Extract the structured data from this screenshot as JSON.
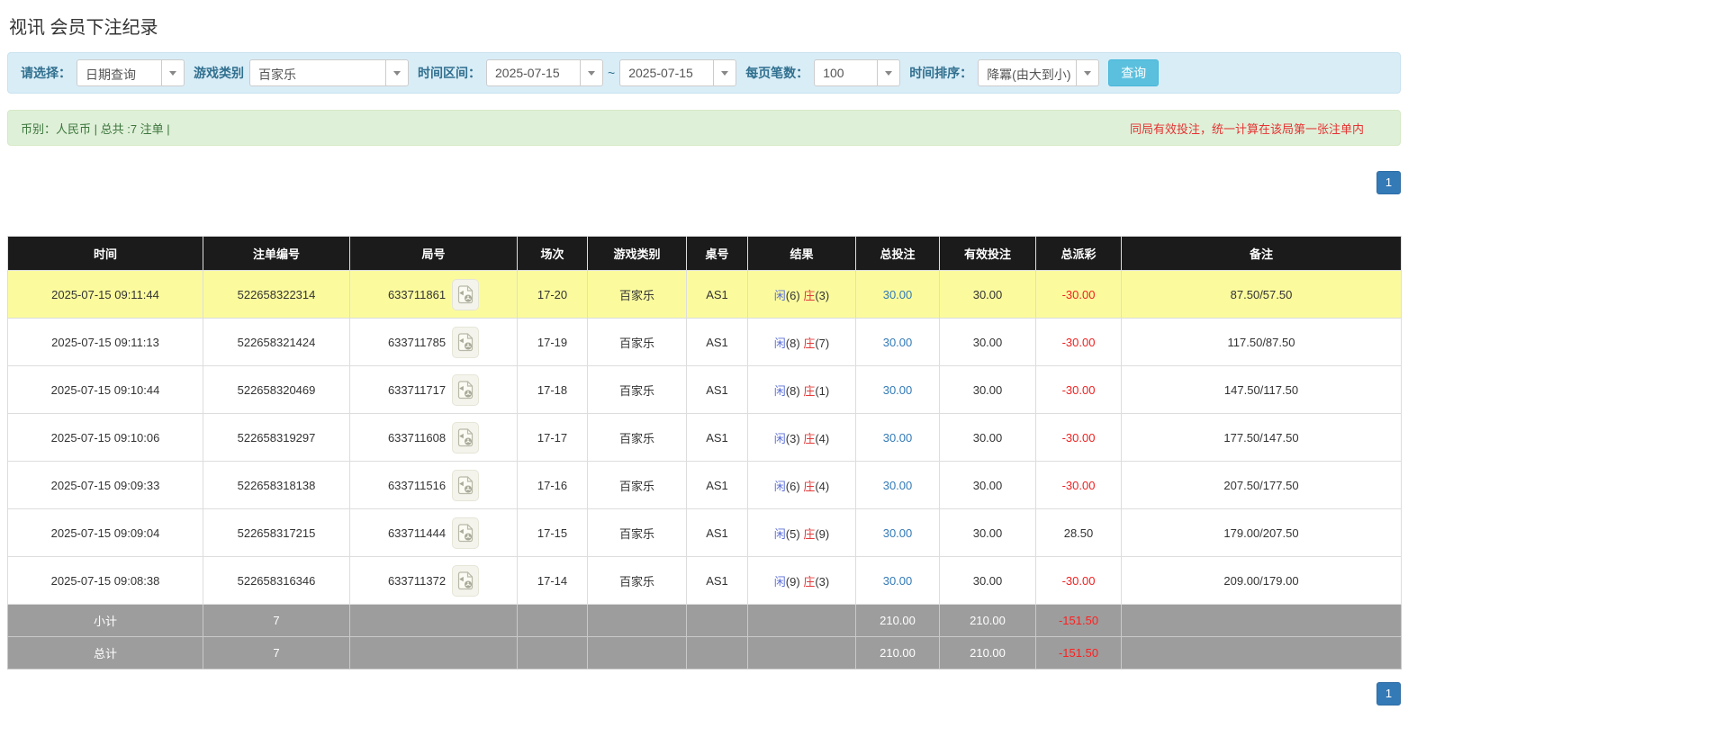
{
  "page": {
    "title": "视讯 会员下注纪录"
  },
  "filters": {
    "select_label": "请选择：",
    "select_value": "日期查询",
    "game_label": "游戏类别",
    "game_value": "百家乐",
    "range_label": "时间区间：",
    "date_from": "2025-07-15",
    "range_separator": "~",
    "date_to": "2025-07-15",
    "per_page_label": "每页笔数：",
    "per_page_value": "100",
    "sort_label": "时间排序：",
    "sort_value": "降冪(由大到小)",
    "search_button": "查询"
  },
  "summary_bar": {
    "left_text": "币别：人民币 | 总共 :7 注单 |",
    "right_text": "同局有效投注，统一计算在该局第一张注单内"
  },
  "pagination": {
    "current_page": "1"
  },
  "table": {
    "headers": [
      "时间",
      "注单编号",
      "局号",
      "场次",
      "游戏类别",
      "桌号",
      "结果",
      "总投注",
      "有效投注",
      "总派彩",
      "备注"
    ],
    "rows": [
      {
        "time": "2025-07-15 09:11:44",
        "bet_id": "522658322314",
        "round_id": "633711861",
        "session": "17-20",
        "game": "百家乐",
        "table_no": "AS1",
        "player": "闲",
        "player_score": "(6)",
        "banker": "庄",
        "banker_score": "(3)",
        "total_bet": "30.00",
        "valid_bet": "30.00",
        "payout": "-30.00",
        "remark": "87.50/57.50",
        "highlight": true
      },
      {
        "time": "2025-07-15 09:11:13",
        "bet_id": "522658321424",
        "round_id": "633711785",
        "session": "17-19",
        "game": "百家乐",
        "table_no": "AS1",
        "player": "闲",
        "player_score": "(8)",
        "banker": "庄",
        "banker_score": "(7)",
        "total_bet": "30.00",
        "valid_bet": "30.00",
        "payout": "-30.00",
        "remark": "117.50/87.50",
        "highlight": false
      },
      {
        "time": "2025-07-15 09:10:44",
        "bet_id": "522658320469",
        "round_id": "633711717",
        "session": "17-18",
        "game": "百家乐",
        "table_no": "AS1",
        "player": "闲",
        "player_score": "(8)",
        "banker": "庄",
        "banker_score": "(1)",
        "total_bet": "30.00",
        "valid_bet": "30.00",
        "payout": "-30.00",
        "remark": "147.50/117.50",
        "highlight": false
      },
      {
        "time": "2025-07-15 09:10:06",
        "bet_id": "522658319297",
        "round_id": "633711608",
        "session": "17-17",
        "game": "百家乐",
        "table_no": "AS1",
        "player": "闲",
        "player_score": "(3)",
        "banker": "庄",
        "banker_score": "(4)",
        "total_bet": "30.00",
        "valid_bet": "30.00",
        "payout": "-30.00",
        "remark": "177.50/147.50",
        "highlight": false
      },
      {
        "time": "2025-07-15 09:09:33",
        "bet_id": "522658318138",
        "round_id": "633711516",
        "session": "17-16",
        "game": "百家乐",
        "table_no": "AS1",
        "player": "闲",
        "player_score": "(6)",
        "banker": "庄",
        "banker_score": "(4)",
        "total_bet": "30.00",
        "valid_bet": "30.00",
        "payout": "-30.00",
        "remark": "207.50/177.50",
        "highlight": false
      },
      {
        "time": "2025-07-15 09:09:04",
        "bet_id": "522658317215",
        "round_id": "633711444",
        "session": "17-15",
        "game": "百家乐",
        "table_no": "AS1",
        "player": "闲",
        "player_score": "(5)",
        "banker": "庄",
        "banker_score": "(9)",
        "total_bet": "30.00",
        "valid_bet": "30.00",
        "payout": "28.50",
        "remark": "179.00/207.50",
        "highlight": false
      },
      {
        "time": "2025-07-15 09:08:38",
        "bet_id": "522658316346",
        "round_id": "633711372",
        "session": "17-14",
        "game": "百家乐",
        "table_no": "AS1",
        "player": "闲",
        "player_score": "(9)",
        "banker": "庄",
        "banker_score": "(3)",
        "total_bet": "30.00",
        "valid_bet": "30.00",
        "payout": "-30.00",
        "remark": "209.00/179.00",
        "highlight": false
      }
    ],
    "subtotal": {
      "label": "小计",
      "count": "7",
      "total_bet": "210.00",
      "valid_bet": "210.00",
      "payout": "-151.50"
    },
    "total": {
      "label": "总计",
      "count": "7",
      "total_bet": "210.00",
      "valid_bet": "210.00",
      "payout": "-151.50"
    }
  },
  "colors": {
    "accent_blue": "#337ab7",
    "search_button_bg": "#5bc0de",
    "filter_bar_bg": "#d9edf7",
    "filter_label_text": "#31708f",
    "summary_bar_bg": "#dff0d8",
    "summary_left_text": "#3c763d",
    "notice_red": "#e53333",
    "table_header_bg": "#1b1b1b",
    "highlight_row_bg": "#fbfb9e",
    "summary_row_bg": "#9d9d9d",
    "negative_red": "#f02020",
    "player_blue": "#5b6fd6",
    "banker_red": "#e23b3b"
  }
}
